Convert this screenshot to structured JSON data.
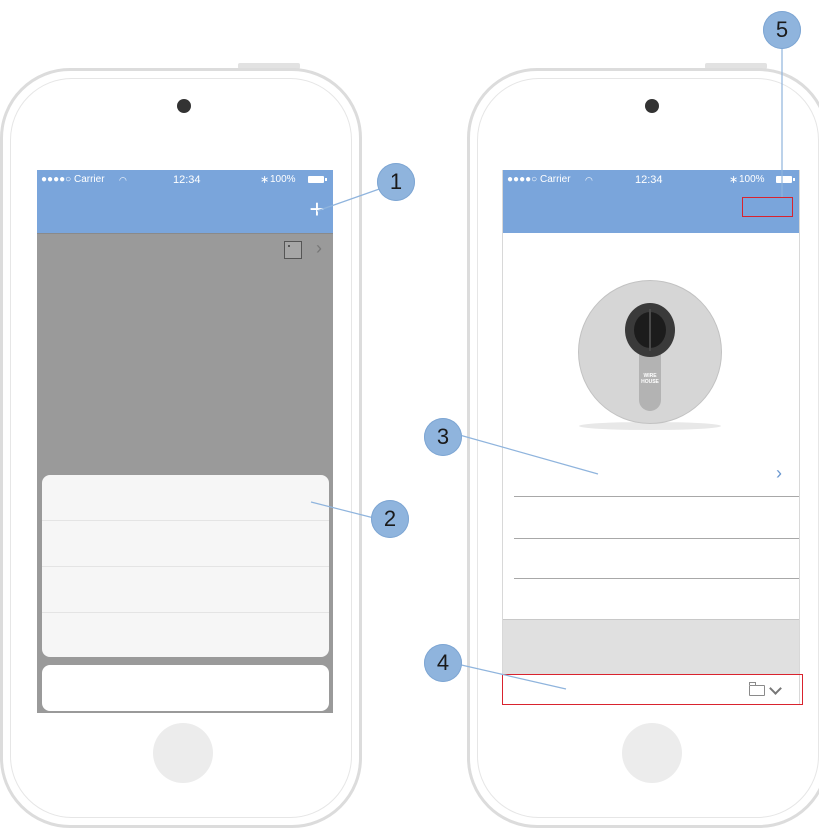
{
  "status_bar": {
    "signal": "●●●●○ Carrier",
    "wifi_icon": "wifi",
    "time": "12:34",
    "bluetooth_icon": "bluetooth",
    "battery": "100%"
  },
  "left_phone": {
    "add_icon": "+",
    "chevron": "›"
  },
  "right_phone": {
    "lock_logo_text": "WIRE\nHOUSE",
    "row_chevron": "›"
  },
  "callouts": {
    "c1": "1",
    "c2": "2",
    "c3": "3",
    "c4": "4",
    "c5": "5"
  },
  "colors": {
    "header_blue": "#7aa5db",
    "overlay_gray": "#9a9a9a",
    "callout_blue": "#8fb4dd",
    "highlight_red": "#d9232e"
  }
}
